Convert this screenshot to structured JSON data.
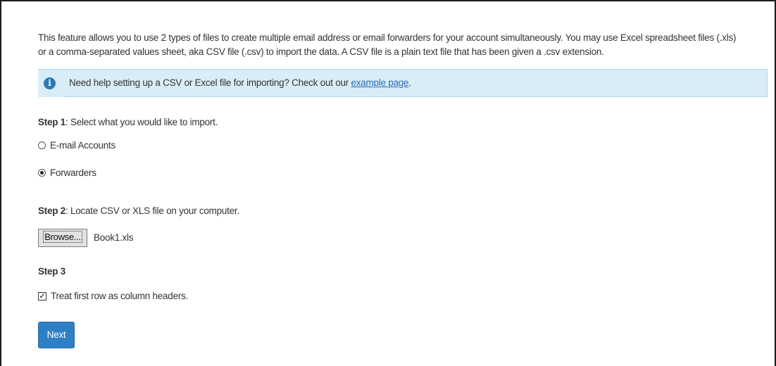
{
  "intro": {
    "line1": "This feature allows you to use 2 types of files to create multiple email address or email forwarders for your account simultaneously. You may use Excel spreadsheet files (.xls)",
    "line2": "or a comma-separated values sheet, aka CSV file (.csv) to import the data. A CSV file is a plain text file that has been given a .csv extension."
  },
  "alert": {
    "icon": "info-icon",
    "text": "Need help setting up a CSV or Excel file for importing? Check out our ",
    "link_text": "example page",
    "suffix": "."
  },
  "step1": {
    "label": "Step 1",
    "text": ": Select what you would like to import.",
    "options": [
      {
        "label": "E-mail Accounts",
        "checked": false
      },
      {
        "label": "Forwarders",
        "checked": true
      }
    ]
  },
  "step2": {
    "label": "Step 2",
    "text": ": Locate CSV or XLS file on your computer.",
    "browse_label": "Browse...",
    "file_name": "Book1.xls"
  },
  "step3": {
    "label": "Step 3",
    "checkbox_label": "Treat first row as column headers.",
    "checked": true
  },
  "next_label": "Next",
  "colors": {
    "alert_bg": "#d9edf7",
    "primary": "#2d80c6",
    "link": "#2a6bb5"
  }
}
